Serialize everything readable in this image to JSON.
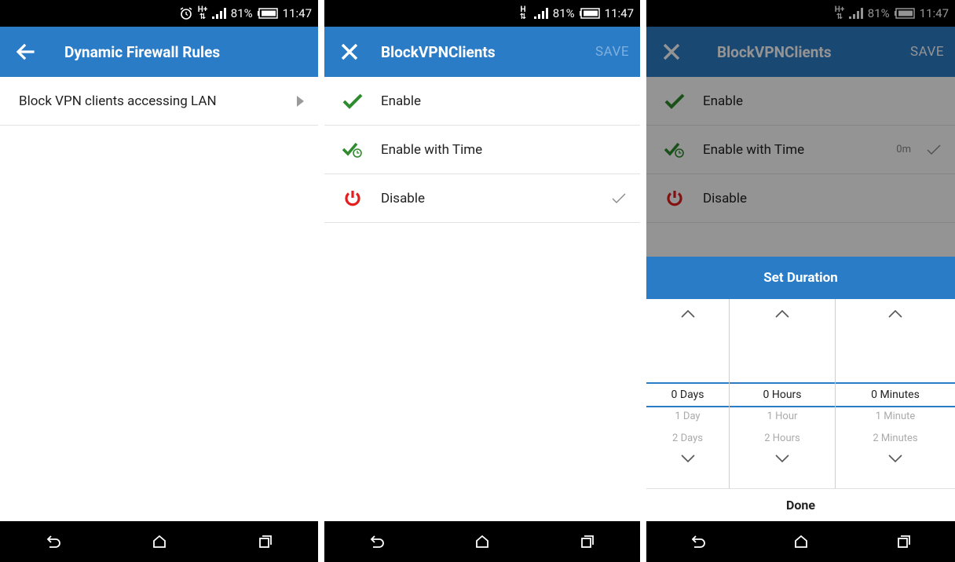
{
  "colors": {
    "accent": "#2b7cc6",
    "green": "#2e8b2e",
    "red": "#e41e1e"
  },
  "screen1": {
    "status": {
      "battery": "81%",
      "time": "11:47"
    },
    "title": "Dynamic Firewall Rules",
    "items": [
      {
        "label": "Block VPN clients accessing LAN"
      }
    ]
  },
  "screen2": {
    "status": {
      "battery": "81%",
      "time": "11:47"
    },
    "title": "BlockVPNClients",
    "save_label": "SAVE",
    "options": [
      {
        "label": "Enable",
        "icon": "check-icon"
      },
      {
        "label": "Enable with Time",
        "icon": "check-clock-icon"
      },
      {
        "label": "Disable",
        "icon": "power-icon",
        "selected": true
      }
    ]
  },
  "screen3": {
    "status": {
      "battery": "81%",
      "time": "11:47"
    },
    "title": "BlockVPNClients",
    "save_label": "SAVE",
    "options": [
      {
        "label": "Enable"
      },
      {
        "label": "Enable with Time",
        "value": "0m",
        "selected": true
      },
      {
        "label": "Disable"
      }
    ],
    "dialog": {
      "title": "Set Duration",
      "columns": [
        {
          "selected": "0 Days",
          "next1": "1 Day",
          "next2": "2 Days"
        },
        {
          "selected": "0 Hours",
          "next1": "1 Hour",
          "next2": "2 Hours"
        },
        {
          "selected": "0 Minutes",
          "next1": "1 Minute",
          "next2": "2 Minutes"
        }
      ],
      "done_label": "Done"
    }
  }
}
